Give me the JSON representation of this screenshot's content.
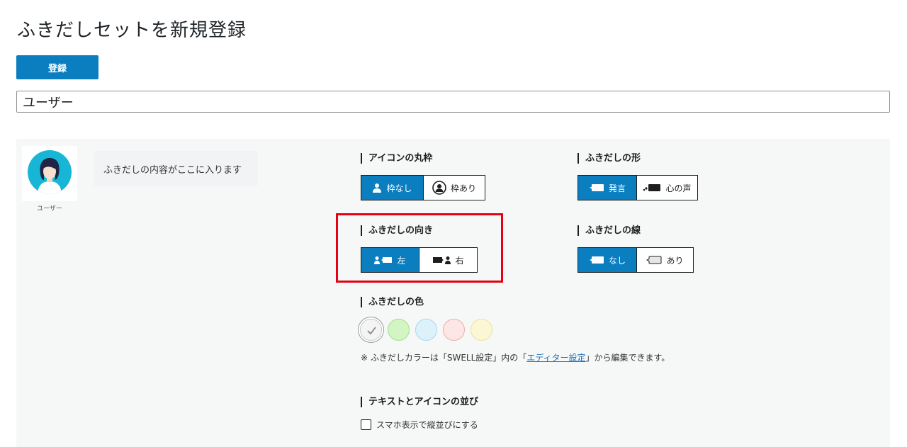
{
  "page": {
    "title": "ふきだしセットを新規登録"
  },
  "toolbar": {
    "register_label": "登録"
  },
  "name_input": {
    "value": "ユーザー"
  },
  "preview": {
    "avatar_name": "ユーザー",
    "bubble_text": "ふきだしの内容がここに入ります"
  },
  "icon_border": {
    "label": "アイコンの丸枠",
    "options": [
      "枠なし",
      "枠あり"
    ],
    "selected": "枠なし"
  },
  "bubble_shape": {
    "label": "ふきだしの形",
    "options": [
      "発言",
      "心の声"
    ],
    "selected": "発言"
  },
  "bubble_direction": {
    "label": "ふきだしの向き",
    "options": [
      "左",
      "右"
    ],
    "selected": "左"
  },
  "bubble_line": {
    "label": "ふきだしの線",
    "options": [
      "なし",
      "あり"
    ],
    "selected": "なし"
  },
  "bubble_color": {
    "label": "ふきだしの色",
    "swatches": [
      {
        "name": "gray",
        "color": "#f4f4f4",
        "border": "#c9c9c9",
        "selected": true
      },
      {
        "name": "green",
        "color": "#d3f5c4",
        "border": "#a3de8c",
        "selected": false
      },
      {
        "name": "blue",
        "color": "#ddf1fb",
        "border": "#a6d8f1",
        "selected": false
      },
      {
        "name": "red",
        "color": "#fde6e6",
        "border": "#f2aaaa",
        "selected": false
      },
      {
        "name": "yellow",
        "color": "#fbf6d4",
        "border": "#efe39b",
        "selected": false
      }
    ],
    "note_prefix": "※ ふきだしカラーは「SWELL設定」内の「",
    "note_link": "エディター設定",
    "note_suffix": "」から編集できます。"
  },
  "text_icon_order": {
    "label": "テキストとアイコンの並び",
    "checkbox_label": "スマホ表示で縦並びにする",
    "checked": false
  },
  "colors": {
    "accent": "#0a7ebf",
    "highlight": "#e60012",
    "avatar_bg": "#17b6d6"
  }
}
